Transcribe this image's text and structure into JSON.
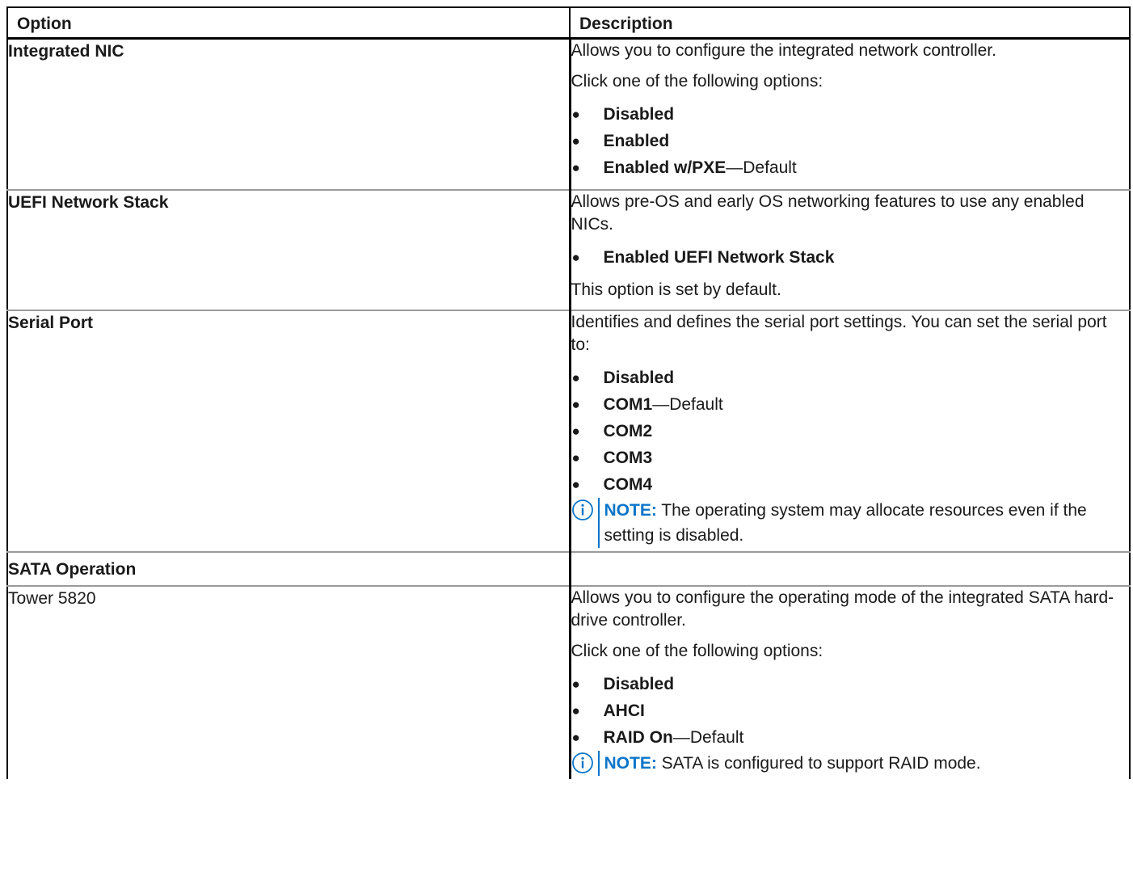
{
  "table": {
    "header": {
      "option": "Option",
      "description": "Description"
    },
    "rows": [
      {
        "option": "Integrated NIC",
        "intro": "Allows you to configure the integrated network controller.",
        "prompt": "Click one of the following options:",
        "items": [
          {
            "label": "Disabled",
            "suffix": ""
          },
          {
            "label": "Enabled",
            "suffix": ""
          },
          {
            "label": "Enabled w/PXE",
            "suffix": "—Default"
          }
        ]
      },
      {
        "option": "UEFI Network Stack",
        "intro": "Allows pre-OS and early OS networking features to use any enabled NICs.",
        "items": [
          {
            "label": "Enabled UEFI Network Stack",
            "suffix": ""
          }
        ],
        "footer": "This option is set by default."
      },
      {
        "option": "Serial Port",
        "intro": "Identifies and defines the serial port settings. You can set the serial port to:",
        "items": [
          {
            "label": "Disabled",
            "suffix": ""
          },
          {
            "label": "COM1",
            "suffix": "—Default"
          },
          {
            "label": "COM2",
            "suffix": ""
          },
          {
            "label": "COM3",
            "suffix": ""
          },
          {
            "label": "COM4",
            "suffix": ""
          }
        ],
        "note": {
          "label": "NOTE:",
          "text": " The operating system may allocate resources even if the setting is disabled."
        }
      },
      {
        "option": "SATA Operation"
      },
      {
        "option": "Tower 5820",
        "intro": "Allows you to configure the operating mode of the integrated SATA hard-drive controller.",
        "prompt": "Click one of the following options:",
        "items": [
          {
            "label": "Disabled",
            "suffix": ""
          },
          {
            "label": "AHCI",
            "suffix": ""
          },
          {
            "label": "RAID On",
            "suffix": "—Default"
          }
        ],
        "note": {
          "label": "NOTE:",
          "text": " SATA is configured to support RAID mode."
        }
      }
    ]
  },
  "icons": {
    "bullet": "●",
    "note_icon": "info-icon"
  },
  "colors": {
    "note_accent": "#0b75c9"
  }
}
